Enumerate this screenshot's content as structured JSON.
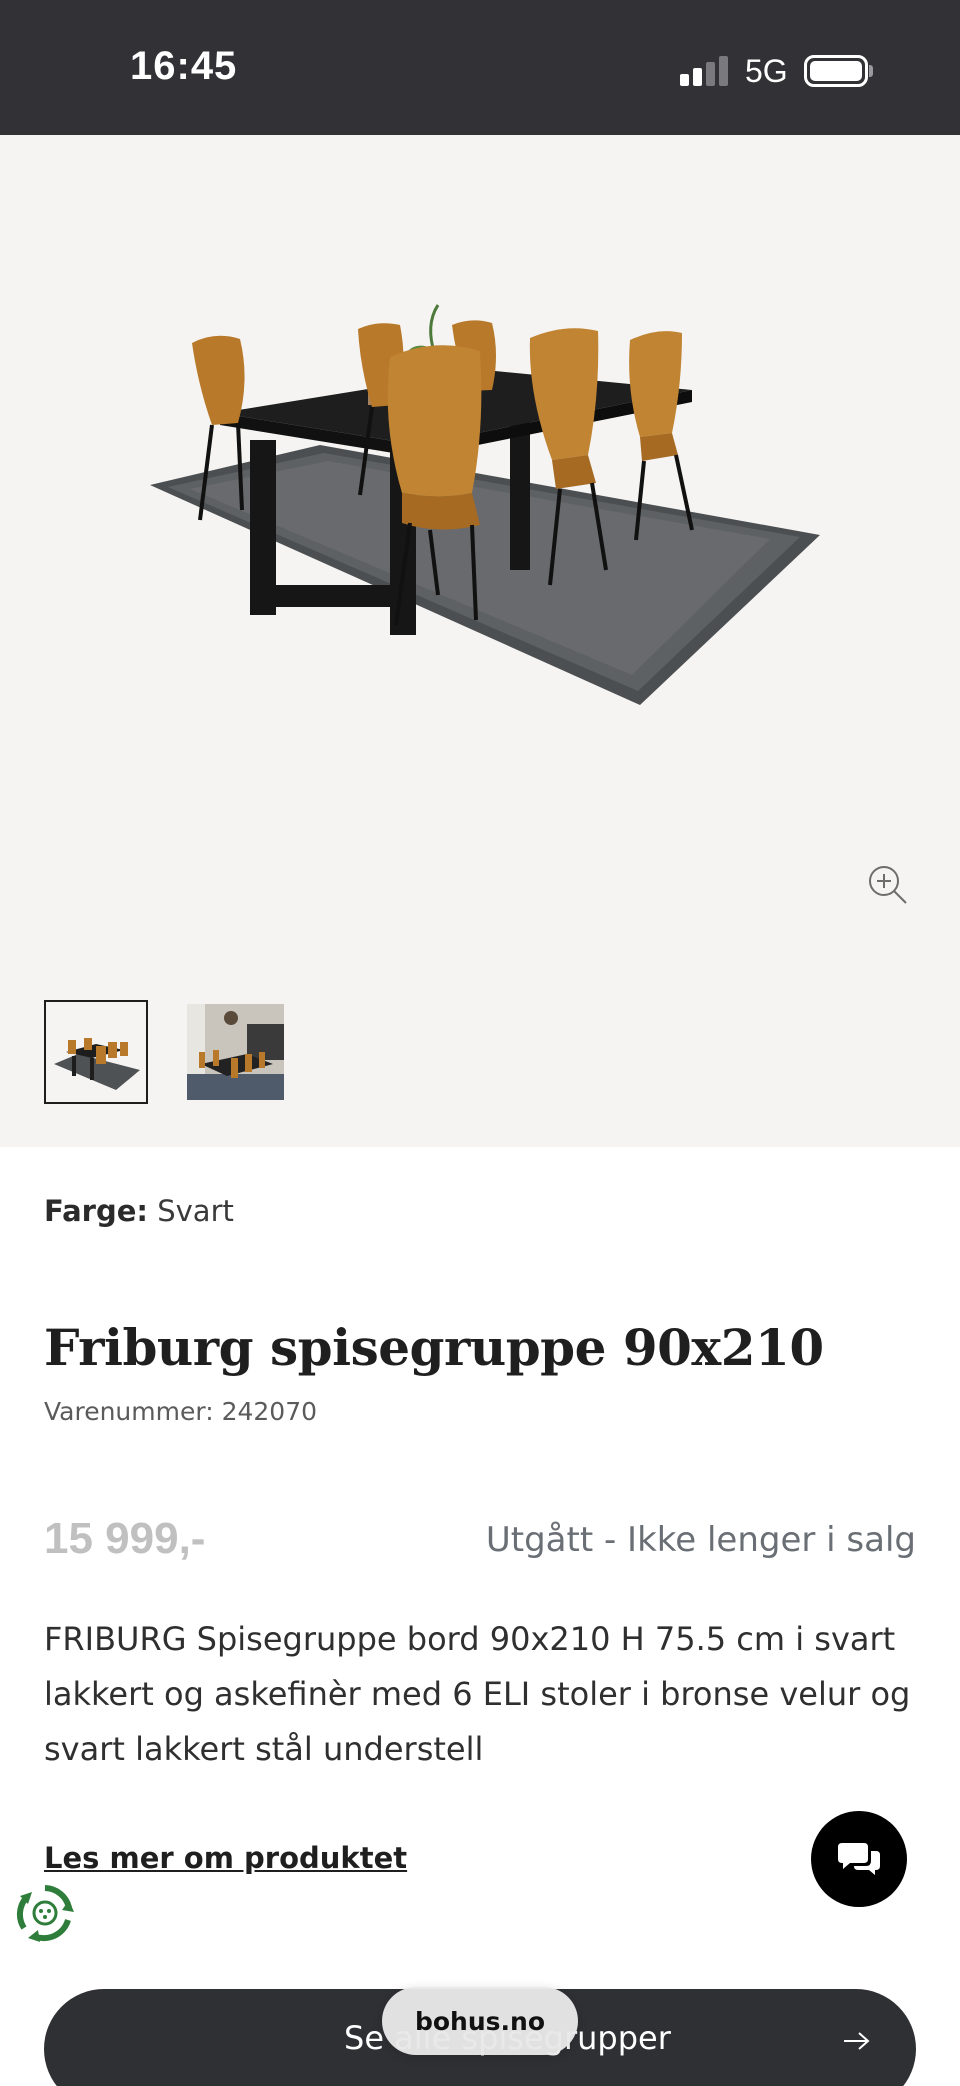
{
  "status_bar": {
    "time": "16:45",
    "network": "5G"
  },
  "gallery": {
    "zoom_icon": "zoom-in-icon",
    "thumbnails": [
      {
        "name": "dining-set-on-rug",
        "selected": true
      },
      {
        "name": "dining-set-in-room",
        "selected": false
      }
    ]
  },
  "product": {
    "color_label": "Farge:",
    "color_value": "Svart",
    "title": "Friburg spisegruppe 90x210",
    "sku": "Varenummer: 242070",
    "price": "15 999,-",
    "availability": "Utgått - Ikke lenger i salg",
    "description": "FRIBURG Spisegruppe bord 90x210 H 75.5 cm i svart lakkert og askefinèr med 6 ELI stoler i bronse velur og svart lakkert stål understell",
    "read_more": "Les mer om produktet"
  },
  "cta": {
    "label": "Se alle spisegrupper",
    "arrow_icon": "arrow-right-icon"
  },
  "browser": {
    "url": "bohus.no"
  },
  "colors": {
    "status_bar": "#323236",
    "gallery_bg": "#f5f4f2",
    "cta_bg": "#2f3034",
    "chair_bronze": "#b8792a",
    "price_muted": "#c0c0c0"
  }
}
